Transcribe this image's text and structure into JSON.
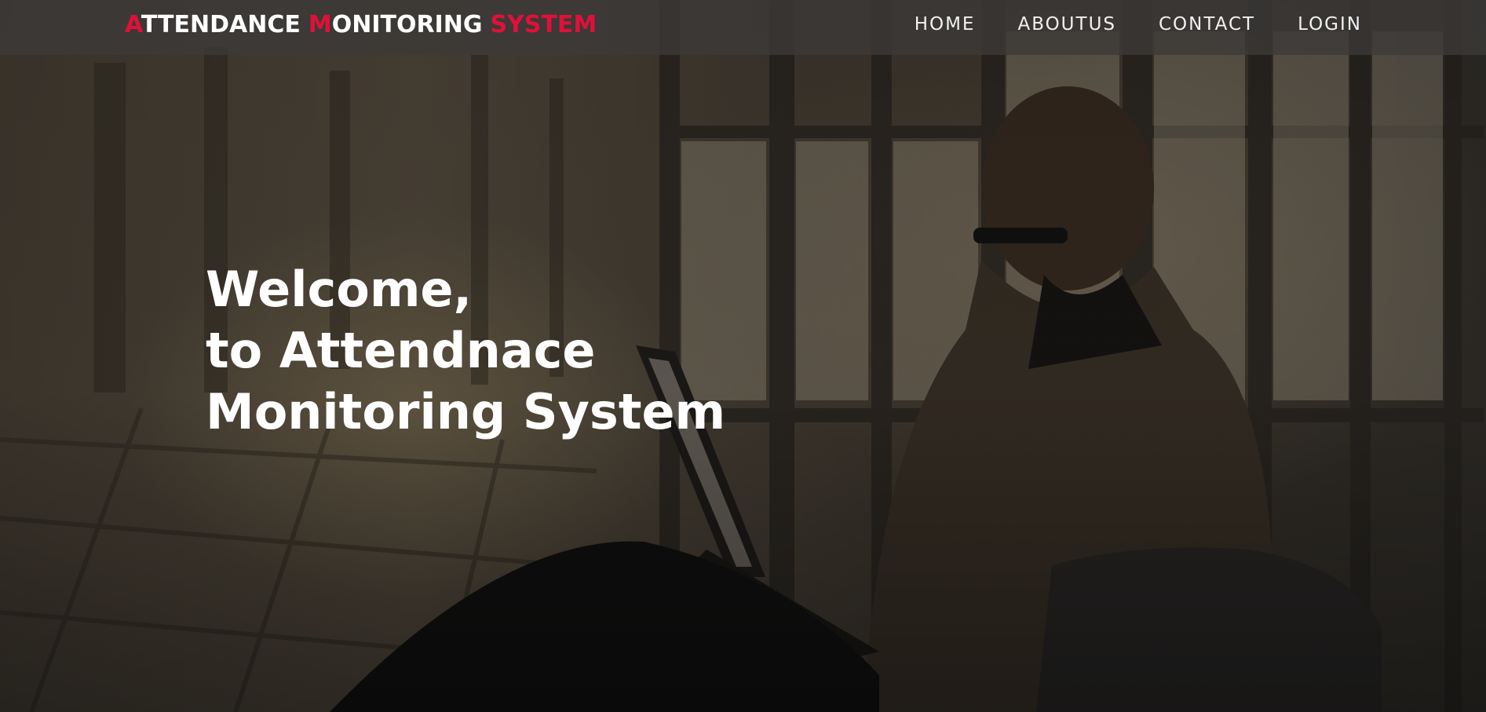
{
  "brand": {
    "word1_initial": "A",
    "word1_rest": "TTENDANCE",
    "word2_initial": "M",
    "word2_rest": "ONITORING",
    "word3": "SYSTEM",
    "accent_color": "#e0103a",
    "text_color": "#ffffff"
  },
  "nav": {
    "items": [
      {
        "label": "HOME"
      },
      {
        "label": "ABOUTUS"
      },
      {
        "label": "CONTACT"
      },
      {
        "label": "LOGIN"
      }
    ]
  },
  "hero": {
    "lines": [
      "Welcome,",
      "to Attendnace",
      "Monitoring System"
    ],
    "background_icon": "man-with-laptop-photo"
  }
}
